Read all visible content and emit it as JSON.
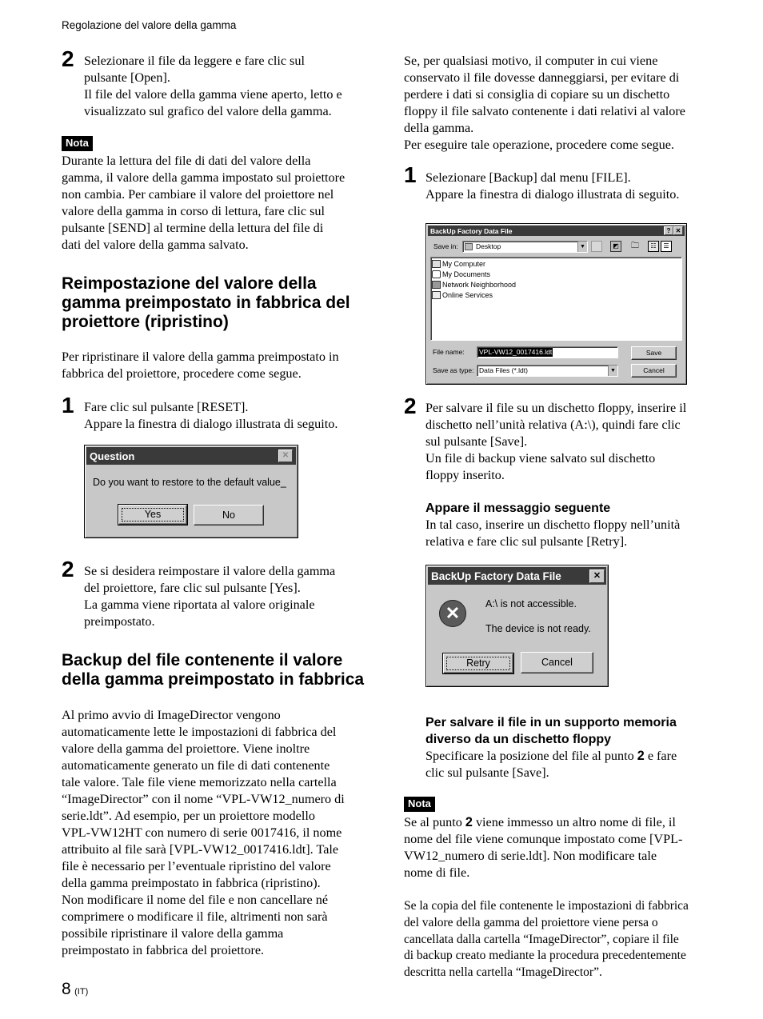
{
  "running_head": "Regolazione del valore della gamma",
  "page_number": "8",
  "page_lang": "(IT)",
  "left": {
    "step2_open": {
      "num": "2",
      "lines": [
        "Selezionare il file da leggere e fare clic sul",
        "pulsante [Open].",
        "Il file del valore della gamma viene aperto, letto e",
        "visualizzato sul grafico del valore della gamma."
      ]
    },
    "nota1": {
      "label": "Nota",
      "lines": [
        "Durante la lettura del file di dati del valore della",
        "gamma, il valore della gamma impostato sul proiettore",
        "non cambia. Per cambiare il valore del proiettore nel",
        "valore della gamma in corso di lettura, fare clic sul",
        "pulsante [SEND] al termine della lettura del file di",
        "dati del valore della gamma salvato."
      ]
    },
    "section_reset": {
      "heading_lines": [
        "Reimpostazione del valore della",
        "gamma preimpostato in fabbrica del",
        "proiettore (ripristino)"
      ],
      "intro_lines": [
        "Per ripristinare il valore della gamma preimpostato in",
        "fabbrica del proiettore, procedere come segue."
      ],
      "step1": {
        "num": "1",
        "lines": [
          "Fare clic sul pulsante [RESET].",
          "Appare la finestra di dialogo illustrata di seguito."
        ]
      },
      "dialog": {
        "title": "Question",
        "message": "Do you want to restore to the default value_",
        "yes_label": "Yes",
        "no_label": "No",
        "close_glyph": "✕"
      },
      "step2": {
        "num": "2",
        "lines": [
          "Se si desidera reimpostare il valore della gamma",
          "del proiettore, fare clic sul pulsante [Yes].",
          "La gamma viene riportata al valore originale",
          "preimpostato."
        ]
      }
    },
    "section_backup": {
      "heading_lines": [
        "Backup del file contenente il valore",
        "della gamma preimpostato in fabbrica"
      ],
      "body_lines": [
        "Al primo avvio di ImageDirector vengono",
        "automaticamente lette le impostazioni di fabbrica del",
        "valore della gamma del proiettore. Viene inoltre",
        "automaticamente generato un file di dati contenente",
        "tale valore. Tale file viene memorizzato nella cartella",
        "“ImageDirector” con il nome “VPL-VW12_numero di",
        "serie.ldt”. Ad esempio, per un proiettore modello",
        "VPL-VW12HT con numero di serie 0017416, il nome",
        "attribuito al file sarà [VPL-VW12_0017416.ldt]. Tale",
        "file è necessario per l’eventuale ripristino del valore",
        "della gamma preimpostato in fabbrica (ripristino).",
        "Non modificare il nome del file e non cancellare né",
        "comprimere o modificare il file, altrimenti non sarà",
        "possibile ripristinare il valore della gamma",
        "preimpostato in fabbrica del proiettore."
      ]
    }
  },
  "right": {
    "intro_lines": [
      "Se, per qualsiasi motivo, il computer in cui viene",
      "conservato il file dovesse danneggiarsi, per evitare di",
      "perdere i dati si consiglia di copiare su un dischetto",
      "floppy il file salvato contenente i dati relativi al valore",
      "della gamma.",
      "Per eseguire tale operazione, procedere come segue."
    ],
    "step1": {
      "num": "1",
      "lines": [
        "Selezionare [Backup] dal menu [FILE].",
        "Appare la finestra di dialogo illustrata di seguito."
      ]
    },
    "save_dialog": {
      "title": "BackUp Factory Data File",
      "help_glyph": "?",
      "close_glyph": "✕",
      "save_in_label": "Save in:",
      "save_in_value": "Desktop",
      "items": [
        {
          "name": "My Computer",
          "icon": "computer-icon"
        },
        {
          "name": "My Documents",
          "icon": "documents-folder-icon"
        },
        {
          "name": "Network Neighborhood",
          "icon": "network-icon"
        },
        {
          "name": "Online Services",
          "icon": "folder-icon"
        }
      ],
      "file_name_label": "File name:",
      "file_name_value": "VPL-VW12_0017416.ldt",
      "save_as_type_label": "Save as type:",
      "save_as_type_value": "Data Files (*.ldt)",
      "save_label": "Save",
      "cancel_label": "Cancel"
    },
    "step2": {
      "num": "2",
      "lines": [
        "Per salvare il file su un dischetto floppy, inserire il",
        "dischetto nell’unità relativa (A:\\), quindi fare clic",
        "sul pulsante [Save].",
        "Un file di backup viene salvato sul dischetto",
        "floppy inserito."
      ]
    },
    "message_heading": "Appare il messaggio seguente",
    "message_lines": [
      "In tal caso, inserire un dischetto floppy nell’unità",
      "relativa e fare clic sul pulsante [Retry]."
    ],
    "error_dialog": {
      "title": "BackUp Factory Data File",
      "close_glyph": "✕",
      "line1": "A:\\ is not accessible.",
      "line2": "The device is not ready.",
      "retry_label": "Retry",
      "cancel_label": "Cancel"
    },
    "other_media_heading_lines": [
      "Per salvare il file in un supporto memoria",
      "diverso da un dischetto floppy"
    ],
    "other_media_text_a": "Specificare la posizione del file al punto ",
    "other_media_bold": "2",
    "other_media_text_b": " e fare",
    "other_media_text_c": "clic sul pulsante [Save].",
    "nota2": {
      "label": "Nota",
      "line1_a": "Se al punto ",
      "line1_bold": "2",
      "line1_b": " viene immesso un altro nome di file, il",
      "lines": [
        "nome del file viene comunque impostato come [VPL-",
        "VW12_numero di serie.ldt]. Non modificare tale",
        "nome di file."
      ]
    },
    "closing_lines": [
      "Se la copia del file contenente le impostazioni di fabbrica",
      "del valore della gamma del proiettore viene persa o",
      "cancellata dalla cartella “ImageDirector”, copiare il file",
      "di backup creato mediante la procedura precedentemente",
      "descritta nella cartella “ImageDirector”."
    ]
  }
}
